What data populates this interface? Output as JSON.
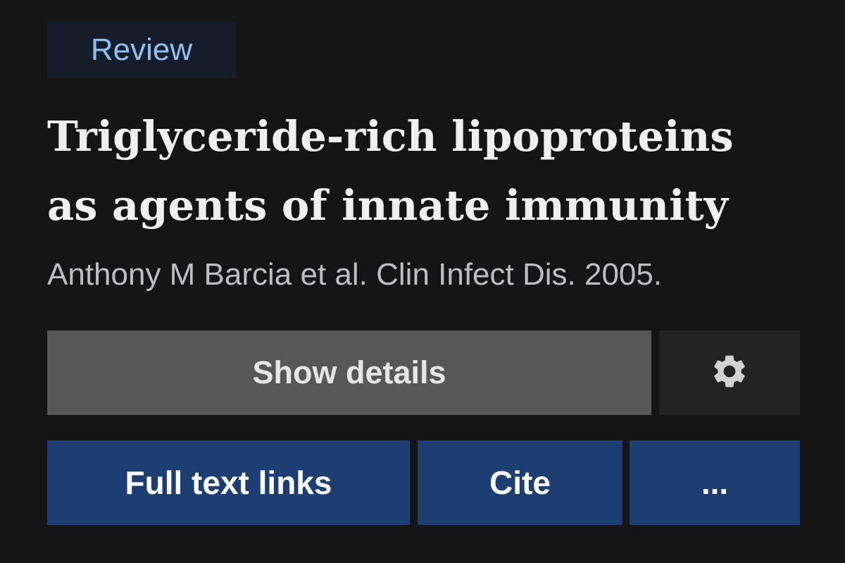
{
  "article": {
    "badge": "Review",
    "title_line1": "Triglyceride-rich lipoproteins",
    "title_line2": "as agents of innate immunity",
    "citation": "Anthony M Barcia et al. Clin Infect Dis. 2005."
  },
  "actions": {
    "show_details_label": "Show details",
    "settings_icon": "gear-icon",
    "full_text_links_label": "Full text links",
    "cite_label": "Cite",
    "more_label": "..."
  },
  "colors": {
    "background": "#151515",
    "badge_background": "#151d2b",
    "badge_text": "#8ec0f2",
    "primary_button": "#1c3e73",
    "secondary_button": "#575757",
    "settings_button": "#232323"
  }
}
